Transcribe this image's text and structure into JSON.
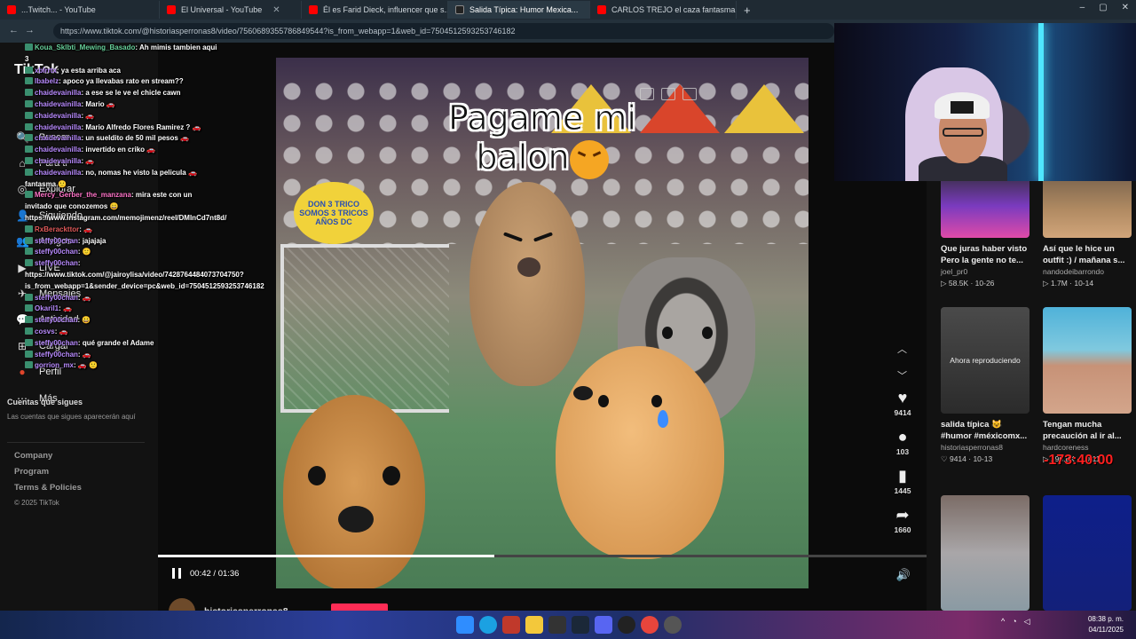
{
  "browser": {
    "tabs": [
      {
        "title": "...Twitch... - YouTube",
        "color": "#ff0000",
        "active": false
      },
      {
        "title": "El Universal - YouTube",
        "color": "#ff0000",
        "active": false
      },
      {
        "title": "Él es Farid Dieck, influencer que s...",
        "color": "#ff0000",
        "active": false
      },
      {
        "title": "Salida Típica: Humor Mexica...",
        "color": "#222222",
        "active": true
      },
      {
        "title": "CARLOS TREJO el caza fantasma...",
        "color": "#ff0000",
        "active": false
      }
    ],
    "new_tab": "+",
    "url": "https://www.tiktok.com/@historiasperronas8/video/7560689355786849544?is_from_webapp=1&web_id=7504512593253746182",
    "window_controls": [
      "–",
      "▢",
      "✕"
    ]
  },
  "sidebar": {
    "logo": "TikTok",
    "nav": [
      {
        "icon": "🔍",
        "label": "Buscar"
      },
      {
        "icon": "⌂",
        "label": "Para ti"
      },
      {
        "icon": "◎",
        "label": "Explorar"
      },
      {
        "icon": "👤",
        "label": "Siguiendo"
      },
      {
        "icon": "👥",
        "label": "Amigos"
      },
      {
        "icon": "▶",
        "label": "LIVE"
      },
      {
        "icon": "✈",
        "label": "Mensajes"
      },
      {
        "icon": "💬",
        "label": "Actividad"
      },
      {
        "icon": "⊞",
        "label": "Cargar"
      },
      {
        "icon": "●",
        "label": "Perfil"
      },
      {
        "icon": "⋯",
        "label": "Más"
      }
    ],
    "following_heading": "Cuentas que sigues",
    "following_note": "Las cuentas que sigues aparecerán aquí",
    "footer": [
      "Company",
      "Program",
      "Terms & Policies"
    ],
    "copyright": "© 2025 TikTok"
  },
  "chat": [
    {
      "user": "Koua_Sklbti_Mewing_Basado",
      "text": "Ah mimis tambien aqui 3",
      "cls": "u g"
    },
    {
      "user": "xblrrtx",
      "text": "ya esta arriba aca",
      "cls": "u"
    },
    {
      "user": "lbabelz",
      "text": "apoco ya llevabas rato en stream??",
      "cls": "u"
    },
    {
      "user": "chaidevainilla",
      "text": "a ese se le ve el chicle cawn",
      "cls": "u"
    },
    {
      "user": "chaidevainilla",
      "text": "Mario 🚗",
      "cls": "u"
    },
    {
      "user": "chaidevainilla",
      "text": "🚗",
      "cls": "u"
    },
    {
      "user": "chaidevainilla",
      "text": "Mario Alfredo Flores Ramirez ? 🚗",
      "cls": "u"
    },
    {
      "user": "chaidevainilla",
      "text": "un sueldito de 50 mil pesos 🚗",
      "cls": "u"
    },
    {
      "user": "chaidevainilla",
      "text": "invertido en criko 🚗",
      "cls": "u"
    },
    {
      "user": "chaidevainilla",
      "text": "🚗",
      "cls": "u"
    },
    {
      "user": "chaidevainilla",
      "text": "no, nomas he visto la pelicula 🚗 fantasma 🙂",
      "cls": "u"
    },
    {
      "user": "Mercy_Gerber_the_manzana",
      "text": "mira este con un invitado que conozemos 😀 https://www.instagram.com/memojimenz/reel/DMlnCd7nt8d/",
      "cls": "u p"
    },
    {
      "user": "RxBerackttor",
      "text": "🚗",
      "cls": "u r"
    },
    {
      "user": "steffy00chan",
      "text": "jajajaja",
      "cls": "u"
    },
    {
      "user": "steffy00chan",
      "text": "🙂",
      "cls": "u"
    },
    {
      "user": "steffy00chan",
      "text": "https://www.tiktok.com/@jairoylisa/video/7428764484073704750?is_from_webapp=1&sender_device=pc&web_id=7504512593253746182",
      "cls": "u"
    },
    {
      "user": "steffy00chan",
      "text": "🚗",
      "cls": "u"
    },
    {
      "user": "Okaril1",
      "text": "🚗",
      "cls": "u"
    },
    {
      "user": "stelfy00chan",
      "text": "😀",
      "cls": "u"
    },
    {
      "user": "cosvs",
      "text": "🚗",
      "cls": "u"
    },
    {
      "user": "steffy00chan",
      "text": "qué grande el Adame",
      "cls": "u"
    },
    {
      "user": "steffy00chan",
      "text": "🚗",
      "cls": "u"
    },
    {
      "user": "gorrion_mx",
      "text": "🚗 🙂",
      "cls": "u"
    }
  ],
  "video": {
    "caption_line1": "Pagame mi",
    "caption_line2": "balon",
    "sign_text": "DON 3 TRICO SOMOS 3 TRICOS AÑOS DC",
    "progress": 0.4375,
    "current_time": "00:42",
    "duration": "01:36",
    "time_text": "00:42 / 01:36",
    "author": "historiasperronas8",
    "likes": "9414",
    "comments": "103",
    "saves": "1445",
    "shares": "1660"
  },
  "grid": [
    {
      "title": "Que juras haber visto Pero la gente no te...",
      "author": "joel_pr0",
      "meta": "▷ 58.5K · 10-26",
      "bg": "linear-gradient(180deg,#2b2b2b,#7a3bbf 55%,#e04aa8)"
    },
    {
      "title": "Así que le hice un outfit :) / mañana s...",
      "author": "nandodeibarrondo",
      "meta": "▷ 1.7M · 10-14",
      "bg": "linear-gradient(180deg,#6e5a48,#b08a62 60%,#d1a57a)"
    },
    {
      "title": "salida típica 😺 #humor #méxicomx...",
      "author": "historiasperronas8",
      "meta": "♡ 9414 · 10-13",
      "bg": "linear-gradient(180deg,#4a4a4a,#2b2b2b)",
      "now": "Ahora reproduciendo"
    },
    {
      "title": "Tengan mucha precaución al ir al...",
      "author": "hardcoreness",
      "meta": "▷ 196.8K · 10-11",
      "bg": "linear-gradient(180deg,#4fb2d9 0%,#7fc9df 40%,#c79277 55%,#d3a58b 100%)"
    },
    {
      "title": "",
      "author": "",
      "meta": "",
      "bg": "linear-gradient(180deg,#7b6c66,#a9a6a8 50%,#8a9aa3)"
    },
    {
      "title": "",
      "author": "",
      "meta": "",
      "bg": "linear-gradient(180deg,#0e1f8a,#13207a)"
    }
  ],
  "stream_timer": "-173:40:00",
  "taskbar": {
    "time": "08:38 p. m.",
    "date": "04/11/2025"
  }
}
